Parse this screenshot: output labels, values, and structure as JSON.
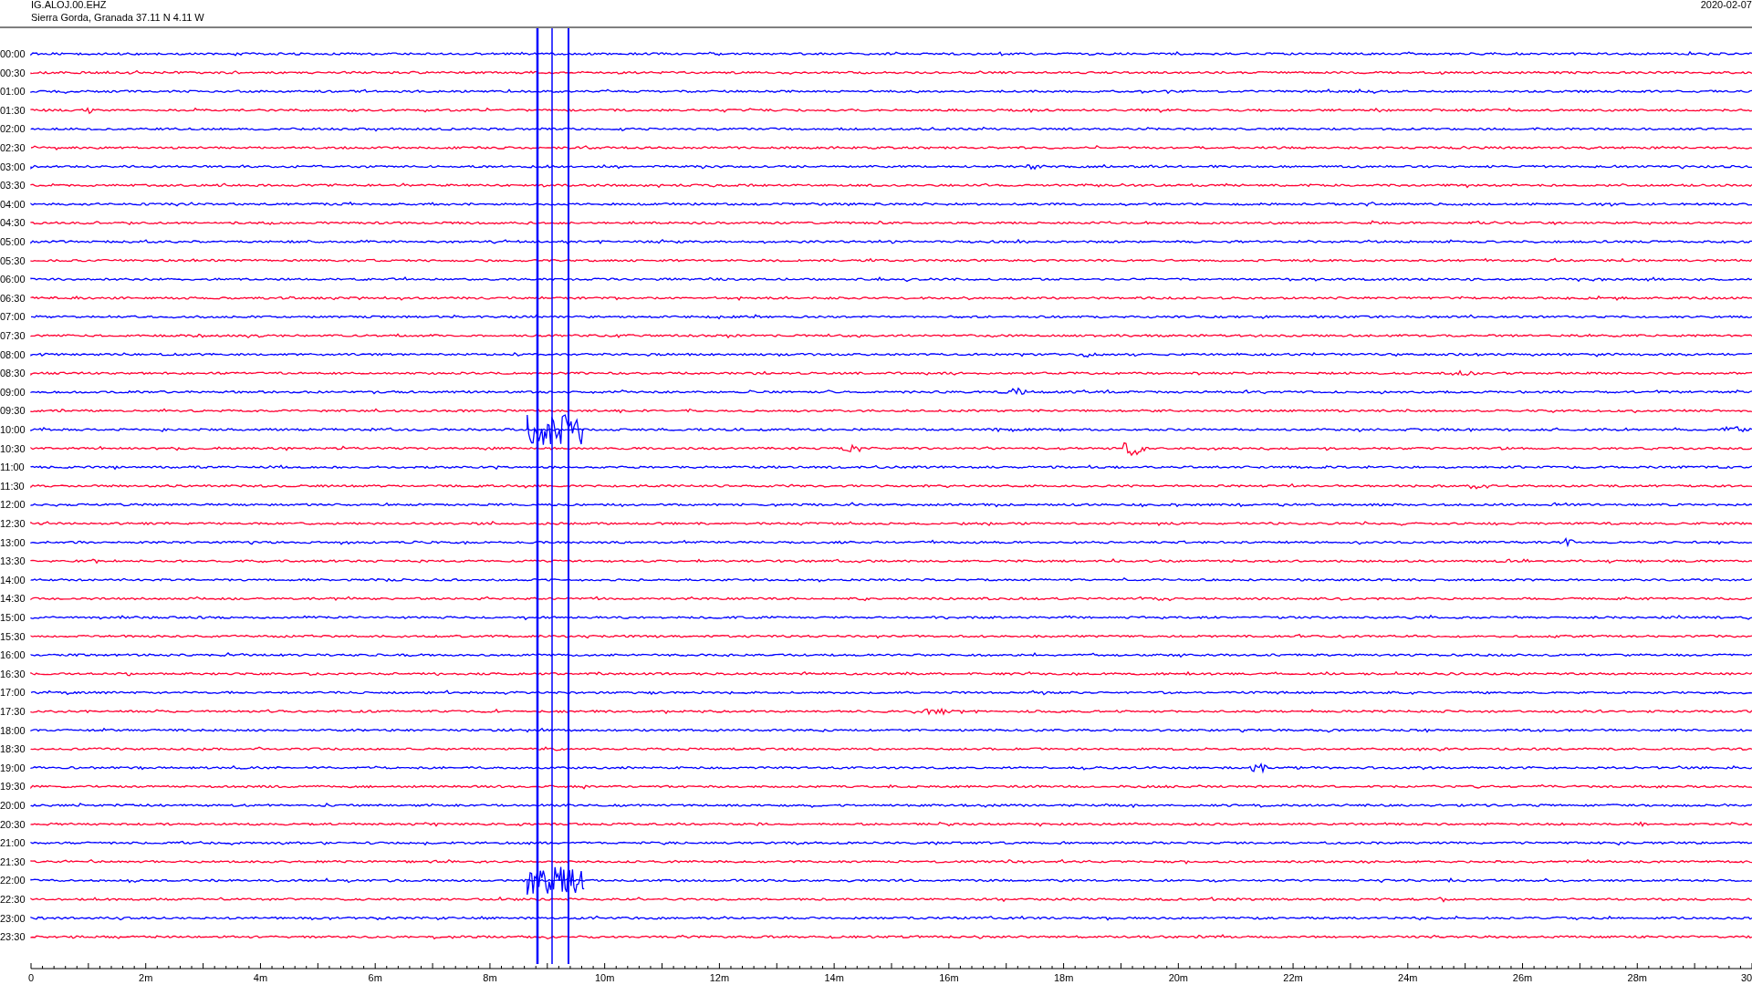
{
  "header": {
    "station": "IG.ALOJ.00.EHZ",
    "location": "Sierra Gorda, Granada  37.11 N 4.11 W",
    "date": "2020-02-07"
  },
  "rows": [
    {
      "label": "00:00",
      "color": "#0000ff"
    },
    {
      "label": "00:30",
      "color": "#ff0033"
    },
    {
      "label": "01:00",
      "color": "#0000ff"
    },
    {
      "label": "01:30",
      "color": "#ff0033"
    },
    {
      "label": "02:00",
      "color": "#0000ff"
    },
    {
      "label": "02:30",
      "color": "#ff0033"
    },
    {
      "label": "03:00",
      "color": "#0000ff"
    },
    {
      "label": "03:30",
      "color": "#ff0033"
    },
    {
      "label": "04:00",
      "color": "#0000ff"
    },
    {
      "label": "04:30",
      "color": "#ff0033"
    },
    {
      "label": "05:00",
      "color": "#0000ff"
    },
    {
      "label": "05:30",
      "color": "#ff0033"
    },
    {
      "label": "06:00",
      "color": "#0000ff"
    },
    {
      "label": "06:30",
      "color": "#ff0033"
    },
    {
      "label": "07:00",
      "color": "#0000ff"
    },
    {
      "label": "07:30",
      "color": "#ff0033"
    },
    {
      "label": "08:00",
      "color": "#0000ff"
    },
    {
      "label": "08:30",
      "color": "#ff0033"
    },
    {
      "label": "09:00",
      "color": "#0000ff"
    },
    {
      "label": "09:30",
      "color": "#ff0033"
    },
    {
      "label": "10:00",
      "color": "#0000ff"
    },
    {
      "label": "10:30",
      "color": "#ff0033"
    },
    {
      "label": "11:00",
      "color": "#0000ff"
    },
    {
      "label": "11:30",
      "color": "#ff0033"
    },
    {
      "label": "12:00",
      "color": "#0000ff"
    },
    {
      "label": "12:30",
      "color": "#ff0033"
    },
    {
      "label": "13:00",
      "color": "#0000ff"
    },
    {
      "label": "13:30",
      "color": "#ff0033"
    },
    {
      "label": "14:00",
      "color": "#0000ff"
    },
    {
      "label": "14:30",
      "color": "#ff0033"
    },
    {
      "label": "15:00",
      "color": "#0000ff"
    },
    {
      "label": "15:30",
      "color": "#ff0033"
    },
    {
      "label": "16:00",
      "color": "#0000ff"
    },
    {
      "label": "16:30",
      "color": "#ff0033"
    },
    {
      "label": "17:00",
      "color": "#0000ff"
    },
    {
      "label": "17:30",
      "color": "#ff0033"
    },
    {
      "label": "18:00",
      "color": "#0000ff"
    },
    {
      "label": "18:30",
      "color": "#ff0033"
    },
    {
      "label": "19:00",
      "color": "#0000ff"
    },
    {
      "label": "19:30",
      "color": "#ff0033"
    },
    {
      "label": "20:00",
      "color": "#0000ff"
    },
    {
      "label": "20:30",
      "color": "#ff0033"
    },
    {
      "label": "21:00",
      "color": "#0000ff"
    },
    {
      "label": "21:30",
      "color": "#ff0033"
    },
    {
      "label": "22:00",
      "color": "#0000ff"
    },
    {
      "label": "22:30",
      "color": "#ff0033"
    },
    {
      "label": "23:00",
      "color": "#0000ff"
    },
    {
      "label": "23:30",
      "color": "#ff0033"
    }
  ],
  "axis": {
    "ticks": [
      "0",
      "2m",
      "4m",
      "6m",
      "8m",
      "10m",
      "12m",
      "14m",
      "16m",
      "18m",
      "20m",
      "22m",
      "24m",
      "26m",
      "28m",
      "30"
    ]
  }
}
